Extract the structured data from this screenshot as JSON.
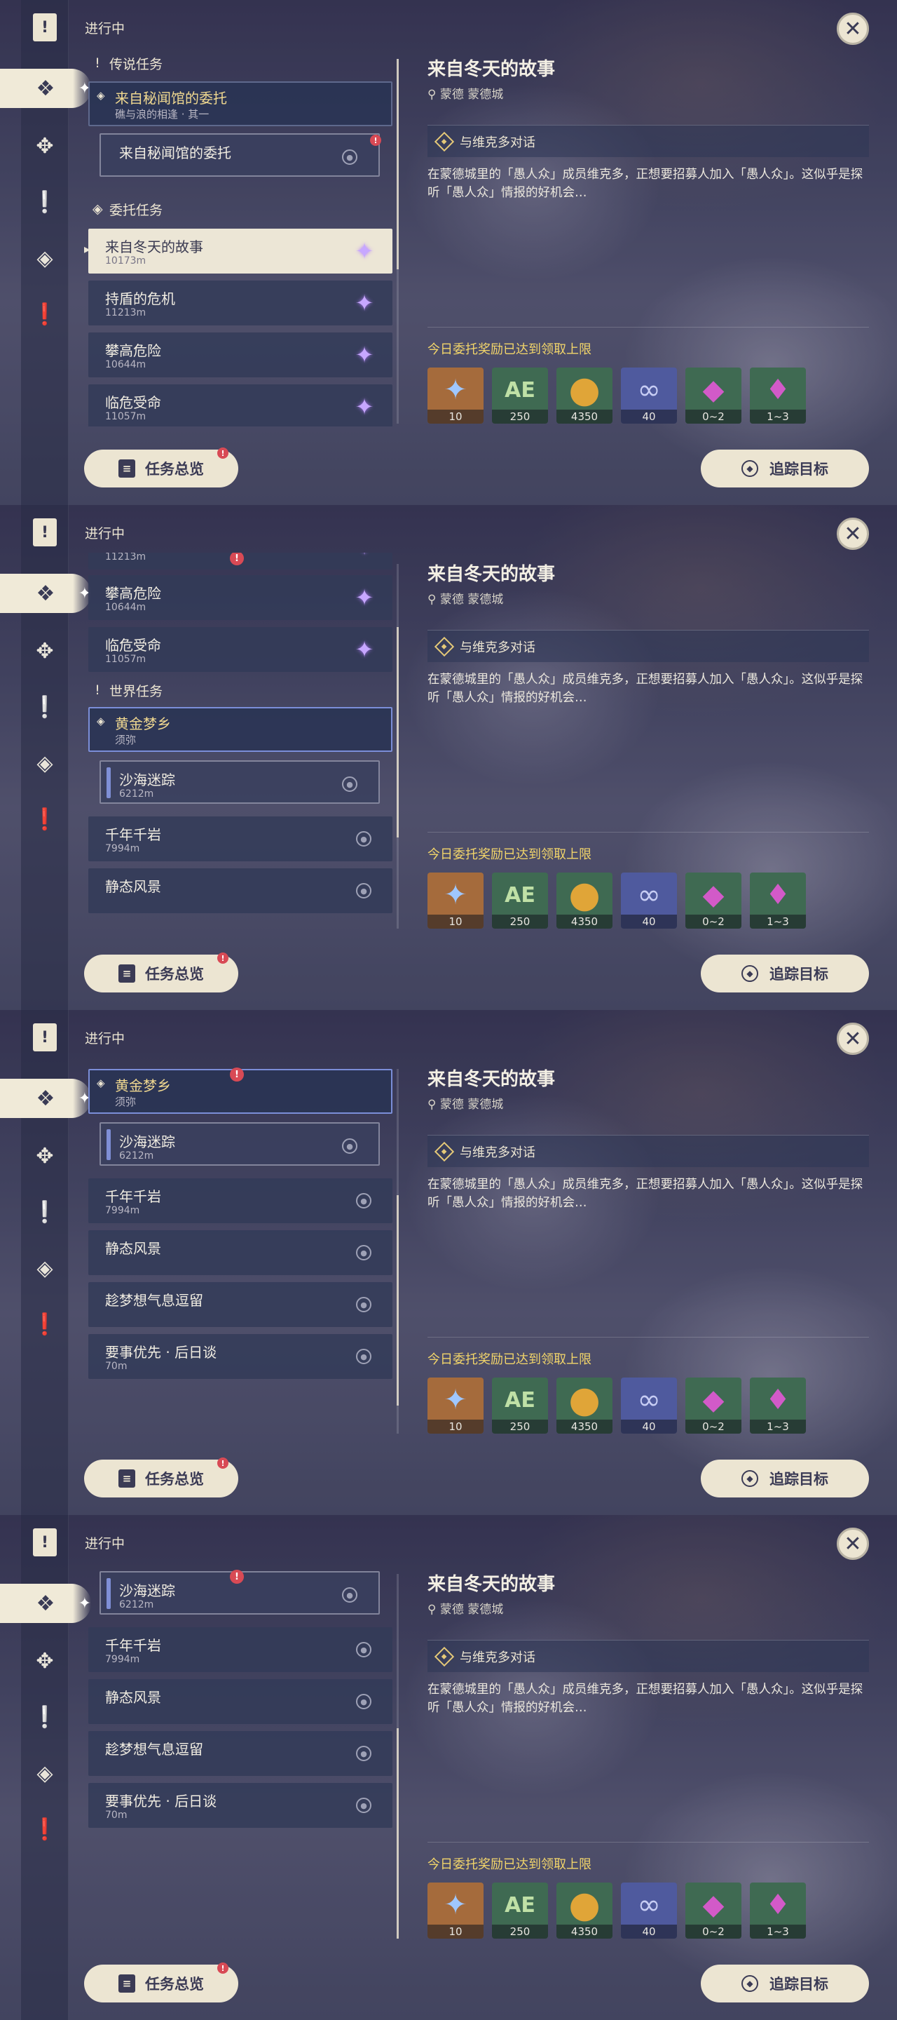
{
  "sidebar": {
    "icons": [
      "quest-book-icon",
      "archon-quest-icon",
      "story-quest-icon",
      "world-quest-icon",
      "commission-icon",
      "event-quest-icon"
    ]
  },
  "header": {
    "title": "进行中",
    "close_glyph": "✕"
  },
  "quests": {
    "legend_section": "传说任务",
    "legend_head_title": "来自秘闻馆的委托",
    "legend_head_desc": "礁与浪的相逢 · 其一",
    "legend_sub": "来自秘闻馆的委托",
    "commission_section": "委托任务",
    "commission_items": [
      {
        "title": "来自冬天的故事",
        "dist": "10173m"
      },
      {
        "title": "持盾的危机",
        "dist": "11213m"
      },
      {
        "title": "攀高危险",
        "dist": "10644m"
      },
      {
        "title": "临危受命",
        "dist": "11057m"
      }
    ],
    "world_section": "世界任务",
    "world_head_title": "黄金梦乡",
    "world_head_desc": "须弥",
    "world_sub_title": "沙海迷踪",
    "world_sub_dist": "6212m",
    "world_items": [
      {
        "title": "千年千岩",
        "dist": "7994m"
      },
      {
        "title": "静态风景",
        "dist": ""
      },
      {
        "title": "趁梦想气息逗留",
        "dist": ""
      },
      {
        "title": "要事优先 · 后日谈",
        "dist": "70m"
      }
    ],
    "partial_prev_dist": "11213m"
  },
  "detail": {
    "title": "来自冬天的故事",
    "location": "蒙德 蒙德城",
    "objective": "与维克多对话",
    "description": "在蒙德城里的「愚人众」成员维克多，正想要招募人加入「愚人众」。这似乎是探听「愚人众」情报的好机会…",
    "reward_notice": "今日委托奖励已达到领取上限",
    "rewards": [
      {
        "icon": "primogem-icon",
        "amount": "10"
      },
      {
        "icon": "adventure-exp-icon",
        "amount": "250"
      },
      {
        "icon": "mora-icon",
        "amount": "4350"
      },
      {
        "icon": "companionship-exp-icon",
        "amount": "40"
      },
      {
        "icon": "crystal-chunk-icon",
        "amount": "0~2"
      },
      {
        "icon": "crystal-ore-icon",
        "amount": "1~3"
      }
    ]
  },
  "buttons": {
    "overview": "任务总览",
    "track": "追踪目标"
  },
  "badge_glyph": "!",
  "colors": {
    "accent_cream": "#ece5d2",
    "notice_yellow": "#f2d56a",
    "badge_red": "#d84a55",
    "world_gold": "#f0d890"
  }
}
